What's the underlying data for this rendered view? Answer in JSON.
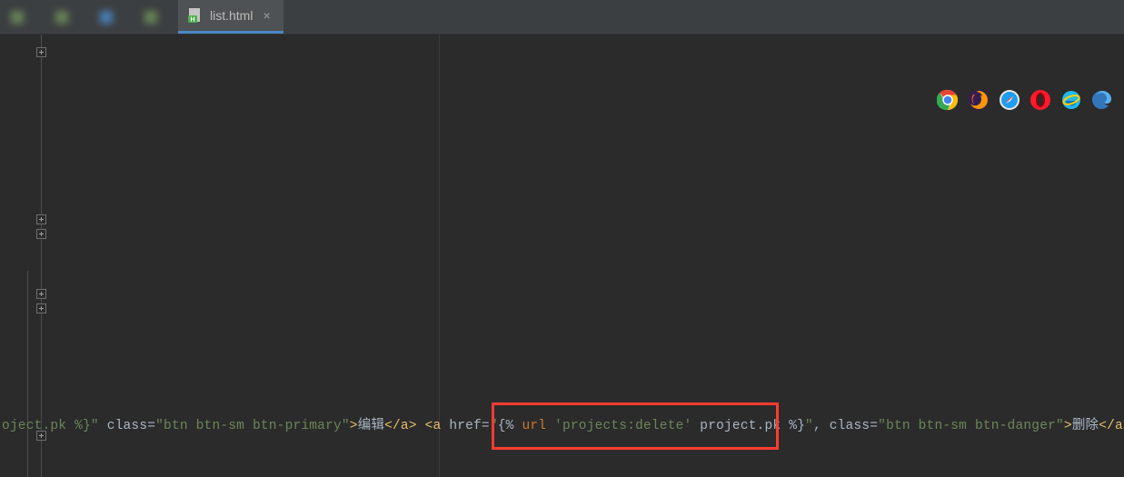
{
  "tabs": {
    "t0": {
      "label": ""
    },
    "t1": {
      "label": ""
    },
    "t2": {
      "label": ""
    },
    "t3": {
      "label": ""
    },
    "t4": {
      "label": "list.html"
    }
  },
  "code": {
    "s1": "oject.pk %}\"",
    "s2": " class=",
    "s3": "\"btn btn-sm btn-primary\"",
    "s4": ">",
    "s5": "编辑",
    "s6": "</a>",
    "s7": " ",
    "s8": "<a ",
    "s9": "href=",
    "s10": "\"",
    "s11": "{% ",
    "s12": "url ",
    "s13": "'projects:delete'",
    "s14": " project.pk ",
    "s15": "%}",
    "s16": "\"",
    "s17": ", class=",
    "s18": "\"btn btn-sm btn-danger\"",
    "s19": ">",
    "s20": "删除",
    "s21": "</a></td>"
  }
}
